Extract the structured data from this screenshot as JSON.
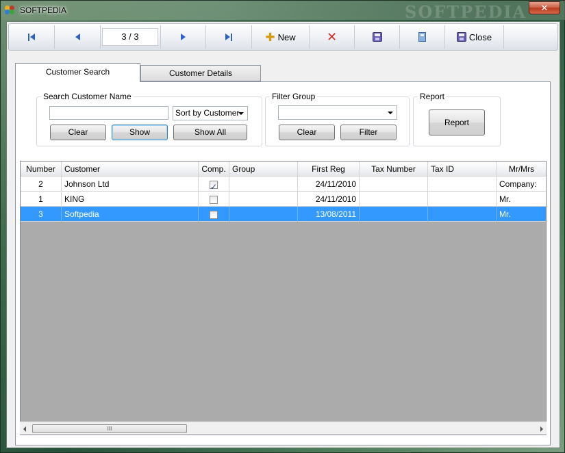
{
  "window": {
    "title": "SOFTPEDIA",
    "watermark": "SOFTPEDIA",
    "close_glyph": "✕"
  },
  "toolbar": {
    "counter": "3 / 3",
    "new_label": "New",
    "close_label": "Close"
  },
  "tabs": [
    {
      "label": "Customer Search"
    },
    {
      "label": "Customer Details"
    }
  ],
  "search_group": {
    "title": "Search Customer Name",
    "input_value": "",
    "sort_selected": "Sort by Customer",
    "clear_label": "Clear",
    "show_label": "Show",
    "show_all_label": "Show All"
  },
  "filter_group": {
    "title": "Filter Group",
    "selected": "",
    "clear_label": "Clear",
    "filter_label": "Filter"
  },
  "report_group": {
    "title": "Report",
    "report_label": "Report"
  },
  "grid": {
    "columns": [
      "Number",
      "Customer",
      "Comp.",
      "Group",
      "First Reg",
      "Tax Number",
      "Tax ID",
      "Mr/Mrs"
    ],
    "rows": [
      {
        "number": "2",
        "customer": "Johnson Ltd",
        "comp": true,
        "group": "",
        "first_reg": "24/11/2010",
        "tax_number": "",
        "tax_id": "",
        "mr_mrs": "Company:"
      },
      {
        "number": "1",
        "customer": "KING",
        "comp": false,
        "group": "",
        "first_reg": "24/11/2010",
        "tax_number": "",
        "tax_id": "",
        "mr_mrs": "Mr."
      },
      {
        "number": "3",
        "customer": "Softpedia",
        "comp": false,
        "group": "",
        "first_reg": "13/08/2011",
        "tax_number": "",
        "tax_id": "",
        "mr_mrs": "Mr.",
        "selected": true
      }
    ],
    "scroll_thumb_glyph": "III"
  },
  "colors": {
    "selection": "#3399ff",
    "nav_arrow": "#2e62c8",
    "delete_x": "#d8281e",
    "new_plus": "#d69a10"
  }
}
